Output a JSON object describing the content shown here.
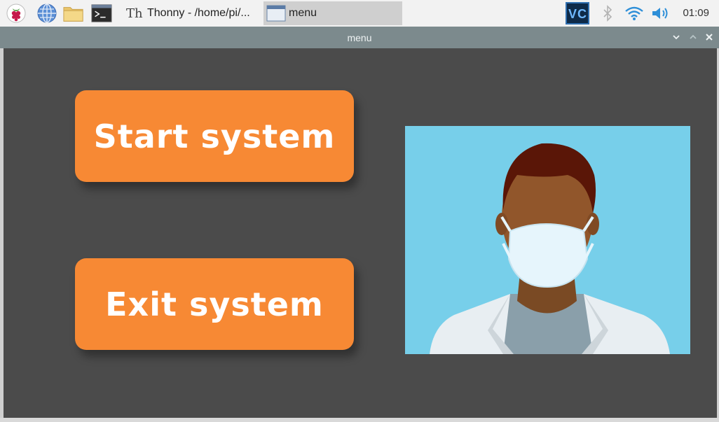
{
  "taskbar": {
    "launchers": [
      {
        "icon": "raspberry-pi-menu-icon"
      },
      {
        "icon": "web-browser-icon"
      },
      {
        "icon": "file-manager-icon"
      },
      {
        "icon": "terminal-icon"
      }
    ],
    "tasks": [
      {
        "label": "Thonny  -  /home/pi/...",
        "icon": "thonny-icon",
        "active": false
      },
      {
        "label": "menu",
        "icon": "window-icon",
        "active": true
      }
    ],
    "tray": {
      "vnc": "vnc-icon",
      "bluetooth": "bluetooth-icon",
      "wifi": "wifi-icon",
      "volume": "volume-icon",
      "clock": "01:09"
    }
  },
  "window": {
    "title": "menu",
    "buttons": {
      "start": "Start system",
      "exit": "Exit system"
    },
    "illustration": {
      "name": "doctor-with-mask-illustration"
    }
  },
  "colors": {
    "client_bg": "#4b4b4b",
    "button": "#f78934",
    "illustration_bg": "#77cfea",
    "titlebar": "#7c8a8d"
  }
}
